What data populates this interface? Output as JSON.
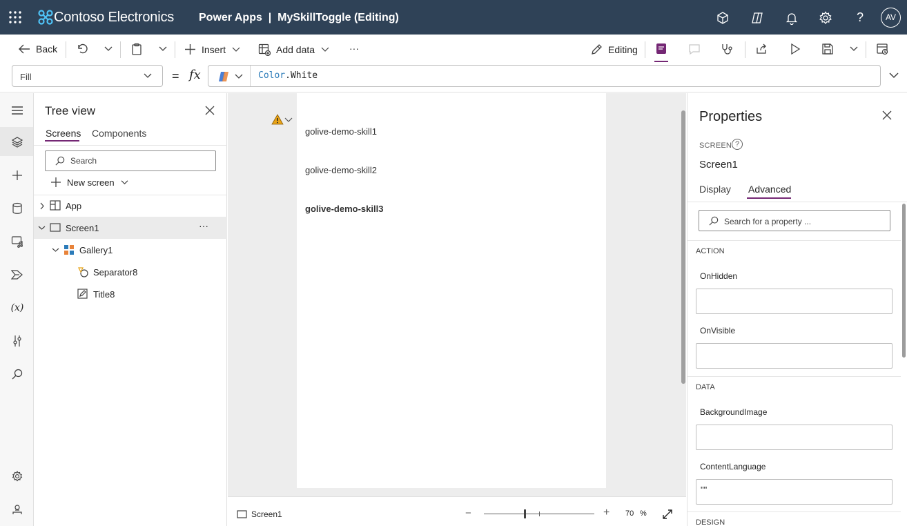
{
  "header": {
    "brand": "Contoso Electronics",
    "app_name": "Power Apps  |  MySkillToggle (Editing)",
    "avatar": "AV",
    "icons": [
      "waffle-icon",
      "environment-icon",
      "copilot-icon",
      "bell-icon",
      "gear-icon",
      "help-icon"
    ]
  },
  "cmdbar": {
    "back": "Back",
    "insert": "Insert",
    "add_data": "Add data",
    "more": "···",
    "editing": "Editing"
  },
  "formula": {
    "property": "Fill",
    "eq": "=",
    "fx": "fx",
    "value_keyword": "Color",
    "value_member": ".White"
  },
  "tree": {
    "title": "Tree view",
    "tab_screens": "Screens",
    "tab_components": "Components",
    "search_placeholder": "Search",
    "new_screen": "New screen",
    "nodes": [
      "App",
      "Screen1",
      "Gallery1",
      "Separator8",
      "Title8"
    ],
    "more": "···"
  },
  "canvas": {
    "items": [
      "golive-demo-skill1",
      "golive-demo-skill2",
      "golive-demo-skill3"
    ]
  },
  "status": {
    "screen": "Screen1",
    "zoom": "70",
    "zoom_unit": "%",
    "zoom_minus": "−",
    "zoom_plus": "+"
  },
  "props": {
    "title": "Properties",
    "type_label": "SCREEN",
    "help": "?",
    "name": "Screen1",
    "tab_display": "Display",
    "tab_advanced": "Advanced",
    "search_placeholder": "Search for a property ...",
    "sections": [
      "ACTION",
      "DATA",
      "DESIGN"
    ],
    "fields": [
      {
        "label": "OnHidden",
        "value": ""
      },
      {
        "label": "OnVisible",
        "value": ""
      },
      {
        "label": "BackgroundImage",
        "value": ""
      },
      {
        "label": "ContentLanguage",
        "value": "\"\""
      }
    ]
  },
  "colors": {
    "header_bg": "#2f4257",
    "accent": "#742774",
    "warning": "#e8a317"
  }
}
